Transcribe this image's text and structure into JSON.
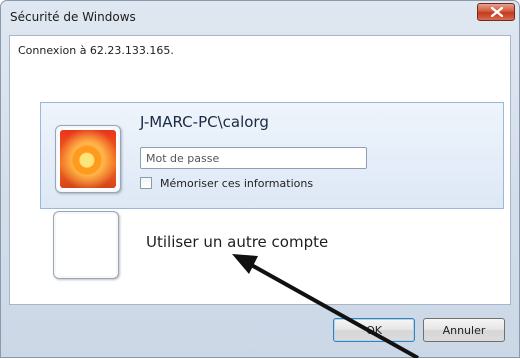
{
  "window": {
    "title": "Sécurité de Windows",
    "close_icon": "close-icon"
  },
  "dialog": {
    "connect_text": "Connexion à 62.23.133.165."
  },
  "account": {
    "username": "J-MARC-PC\\calorg",
    "password_placeholder": "Mot de passe",
    "password_value": "",
    "remember_label": "Mémoriser ces informations",
    "remember_checked": false,
    "avatar_icon": "flower-avatar-icon"
  },
  "other": {
    "label": "Utiliser un autre compte",
    "avatar_icon": "blank-avatar-icon"
  },
  "buttons": {
    "ok": "OK",
    "cancel": "Annuler"
  },
  "annotation": {
    "arrow_icon": "pointer-arrow-icon",
    "color": "#111111"
  },
  "colors": {
    "close_button": "#c43a1c",
    "selection": "#dde8f6"
  }
}
